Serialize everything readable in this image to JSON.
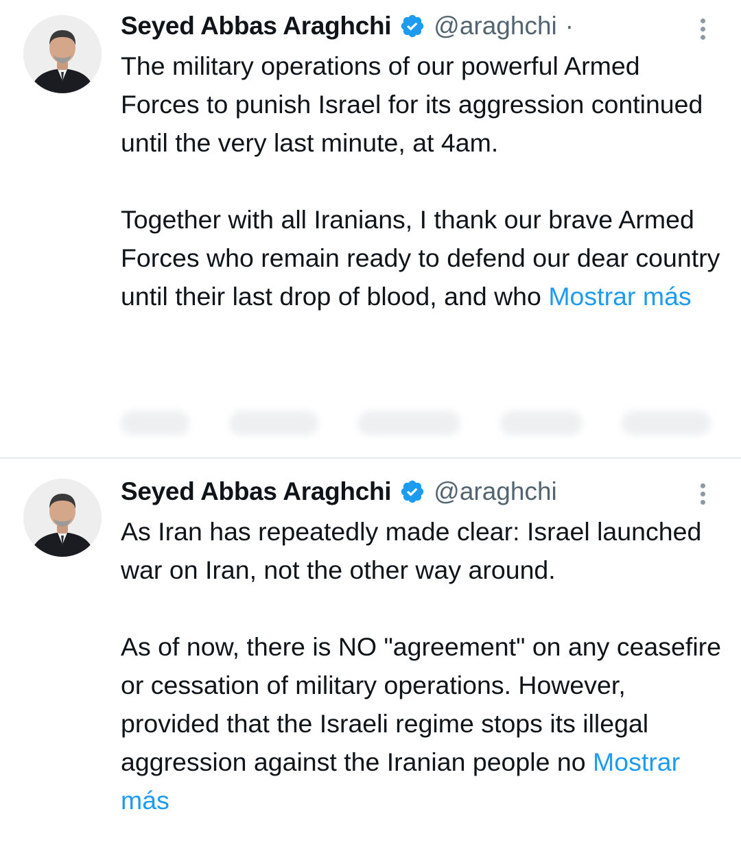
{
  "tweets": [
    {
      "author": {
        "display_name": "Seyed Abbas Araghchi",
        "handle": "@araghchi",
        "separator": "·",
        "verified": true,
        "avatar": "avatar-photo"
      },
      "text_main": "The military operations of our powerful Armed Forces to punish Israel for its aggression continued until the very last minute, at 4am.\n\nTogether with all Iranians, I thank our brave Armed Forces who remain ready to defend our dear country until their last drop of blood, and who ",
      "show_more_label": "Mostrar más",
      "menu_icon": "more-vertical-icon"
    },
    {
      "author": {
        "display_name": "Seyed Abbas Araghchi",
        "handle": "@araghchi",
        "verified": true,
        "avatar": "avatar-photo"
      },
      "text_main": "As Iran has repeatedly made clear: Israel launched war on Iran, not the other way around.\n\nAs of now, there is NO \"agreement\" on any ceasefire or cessation of military operations. However, provided that the Israeli regime stops its illegal aggression against the Iranian people no ",
      "show_more_label": "Mostrar más",
      "menu_icon": "more-vertical-icon"
    }
  ],
  "colors": {
    "link": "#1d9bf0",
    "verified_badge": "#1d9bf0",
    "secondary_text": "#536471",
    "primary_text": "#0f1419",
    "divider": "#e6e9ec"
  }
}
